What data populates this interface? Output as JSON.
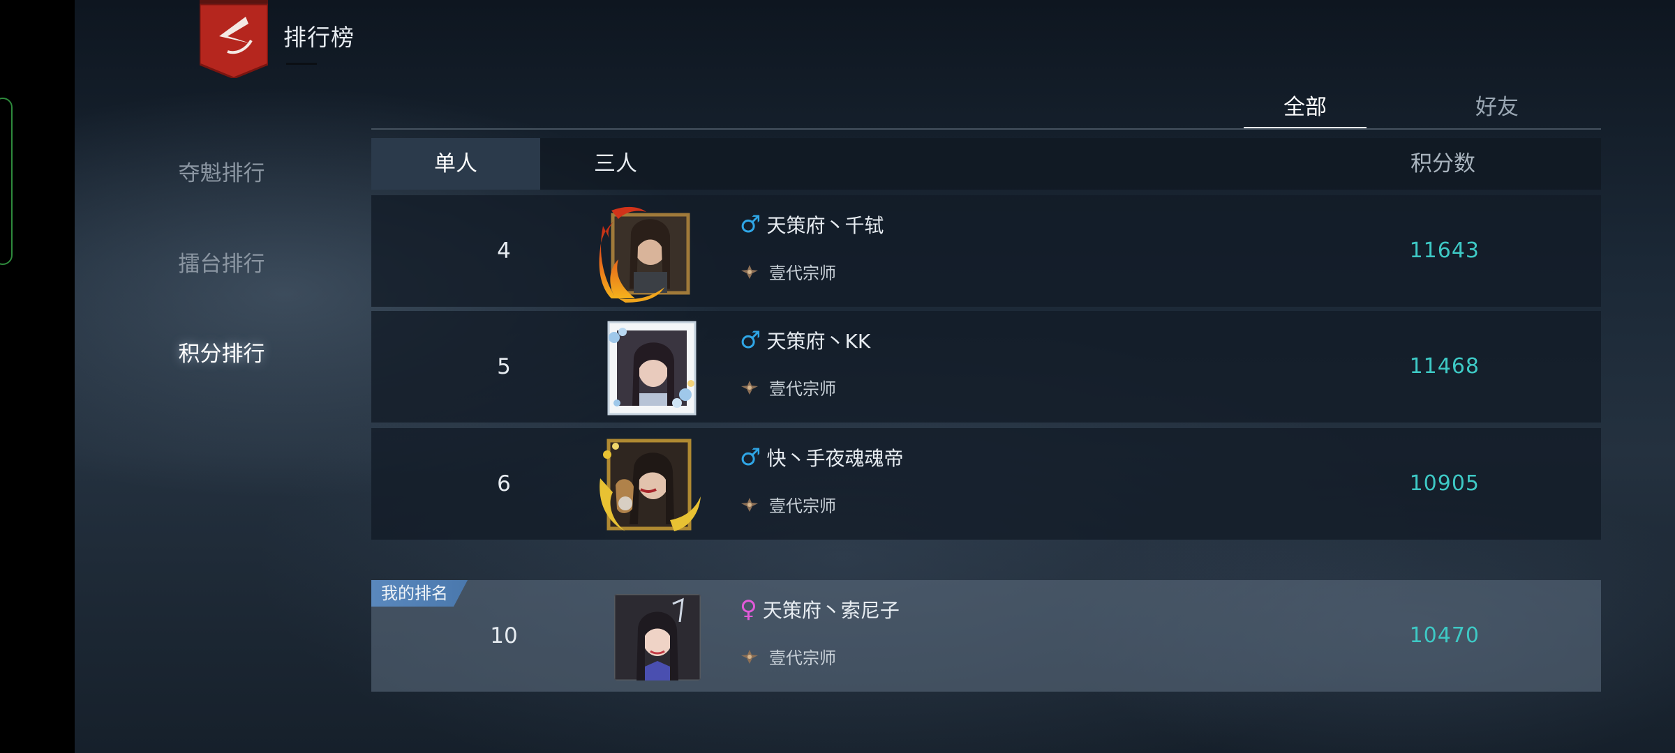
{
  "header": {
    "title": "排行榜"
  },
  "menu": {
    "items": [
      {
        "label": "夺魁排行",
        "active": false
      },
      {
        "label": "擂台排行",
        "active": false
      },
      {
        "label": "积分排行",
        "active": true
      }
    ]
  },
  "scope_tabs": [
    {
      "label": "全部",
      "active": true
    },
    {
      "label": "好友",
      "active": false
    }
  ],
  "table": {
    "mode_tabs": [
      {
        "label": "单人",
        "active": true
      },
      {
        "label": "三人",
        "active": false
      }
    ],
    "score_header": "积分数",
    "rows": [
      {
        "rank": "4",
        "gender": "male",
        "gender_symbol": "♂",
        "name": "天策府丶千轼",
        "title": "壹代宗师",
        "score": "11643",
        "frame": "flame"
      },
      {
        "rank": "5",
        "gender": "male",
        "gender_symbol": "♂",
        "name": "天策府丶KK",
        "title": "壹代宗师",
        "score": "11468",
        "frame": "blossom"
      },
      {
        "rank": "6",
        "gender": "male",
        "gender_symbol": "♂",
        "name": "快丶手夜魂魂帝",
        "title": "壹代宗师",
        "score": "10905",
        "frame": "gold"
      }
    ],
    "my_rank": {
      "badge": "我的排名",
      "rank": "10",
      "gender": "female",
      "gender_symbol": "♀",
      "name": "天策府丶索尼子",
      "title": "壹代宗师",
      "score": "10470"
    }
  },
  "colors": {
    "score": "#3ec9c5",
    "male": "#2fa6e6",
    "female": "#e15ad8",
    "logo": "#b5261e"
  }
}
